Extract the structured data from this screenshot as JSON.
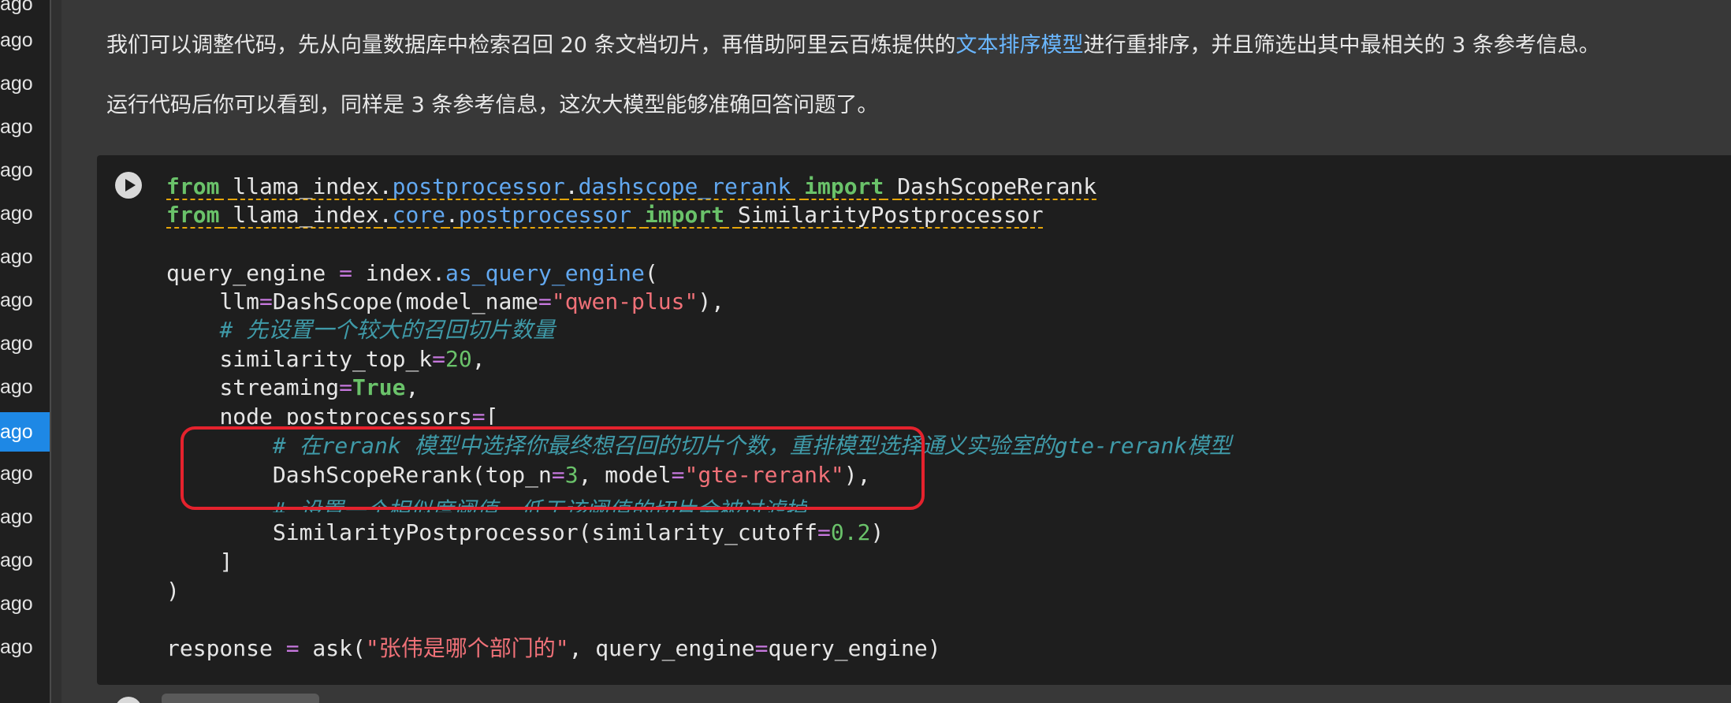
{
  "sidebar": {
    "items": [
      {
        "label": "ago"
      },
      {
        "label": "ago"
      },
      {
        "label": "ago"
      },
      {
        "label": "ago"
      },
      {
        "label": "ago"
      },
      {
        "label": "ago"
      },
      {
        "label": "ago"
      },
      {
        "label": "ago"
      },
      {
        "label": "ago"
      },
      {
        "label": "ago",
        "active": true
      },
      {
        "label": "ago"
      },
      {
        "label": "ago"
      },
      {
        "label": "ago"
      },
      {
        "label": "ago"
      },
      {
        "label": "ago"
      },
      {
        "label": "ago"
      }
    ]
  },
  "markdown": {
    "p1_before": "我们可以调整代码，先从向量数据库中检索召回 20 条文档切片，再借助阿里云百炼提供的",
    "p1_link": "文本排序模型",
    "p1_after": "进行重排序，并且筛选出其中最相关的 3 条参考信息。",
    "p2": "运行代码后你可以看到，同样是 3 条参考信息，这次大模型能够准确回答问题了。"
  },
  "code": {
    "l1": {
      "kw1": "from",
      "mod1": "llama_index",
      "dot1": ".",
      "mod2": "postprocessor",
      "dot2": ".",
      "mod3": "dashscope_rerank",
      "kw2": "import",
      "name": "DashScopeRerank"
    },
    "l2": {
      "kw1": "from",
      "mod1": "llama_index",
      "dot1": ".",
      "mod2": "core",
      "dot2": ".",
      "mod3": "postprocessor",
      "kw2": "import",
      "name": "SimilarityPostprocessor"
    },
    "l4": {
      "a": "query_engine",
      "op": "=",
      "b": "index.",
      "fn": "as_query_engine",
      "c": "("
    },
    "l5": {
      "a": "llm",
      "op1": "=",
      "b": "DashScope(model_name",
      "op2": "=",
      "str": "\"qwen-plus\"",
      "c": "),"
    },
    "l6": {
      "cmt": "# 先设置一个较大的召回切片数量"
    },
    "l7": {
      "a": "similarity_top_k",
      "op": "=",
      "num": "20",
      "c": ","
    },
    "l8": {
      "a": "streaming",
      "op": "=",
      "bool": "True",
      "c": ","
    },
    "l9": {
      "a": "node_postprocessors",
      "op": "=",
      "c": "["
    },
    "l10": {
      "cmt": "# 在rerank 模型中选择你最终想召回的切片个数，重排模型选择通义实验室的gte-rerank模型"
    },
    "l11": {
      "a": "DashScopeRerank(top_n",
      "op1": "=",
      "num": "3",
      "b": ", model",
      "op2": "=",
      "str": "\"gte-rerank\"",
      "c": "),"
    },
    "l12": {
      "cmt": "# 设置一个相似度阈值，低于该阈值的切片会被过滤掉"
    },
    "l13": {
      "a": "SimilarityPostprocessor(similarity_cutoff",
      "op": "=",
      "num": "0.2",
      "c": ")"
    },
    "l14": {
      "a": "]"
    },
    "l15": {
      "a": ")"
    },
    "l17": {
      "a": "response ",
      "op1": "=",
      "b": " ask(",
      "str": "\"张伟是哪个部门的\"",
      "c": ", query_engine",
      "op2": "=",
      "d": "query_engine)"
    }
  },
  "colors": {
    "sidebar_active": "#1e88e5",
    "annotation_box": "#e5222d",
    "link": "#6ab7ff"
  }
}
